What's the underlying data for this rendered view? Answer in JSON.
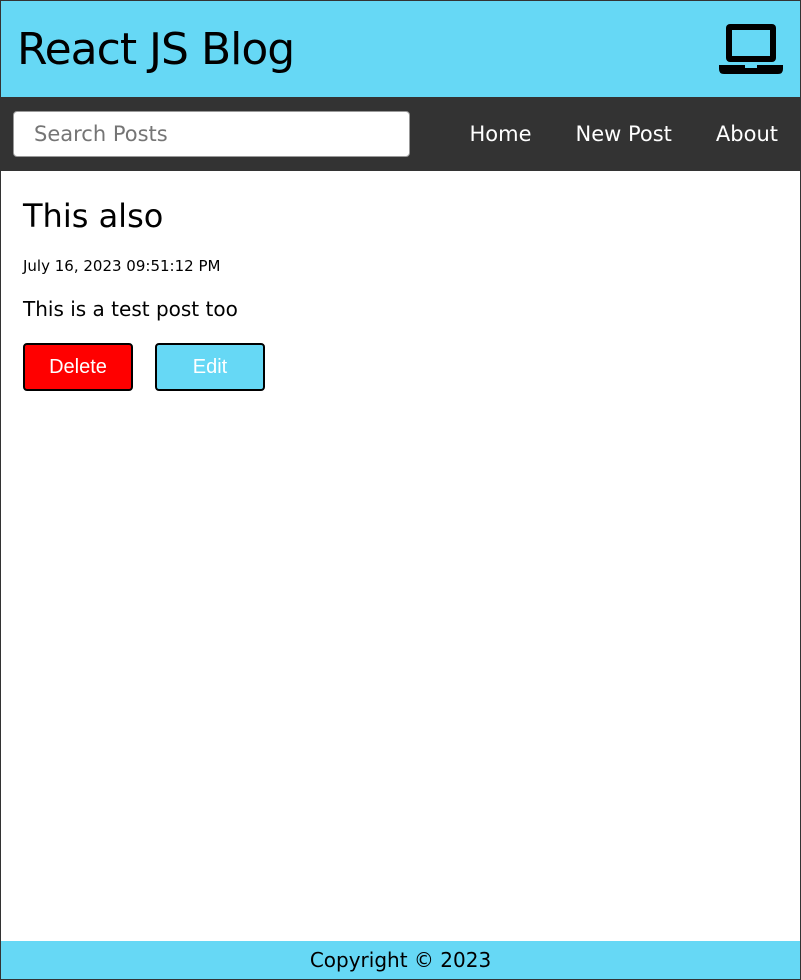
{
  "header": {
    "title": "React JS Blog",
    "icon": "laptop-icon",
    "background_color": "#66d8f5"
  },
  "nav": {
    "search": {
      "placeholder": "Search Posts",
      "value": ""
    },
    "links": [
      {
        "label": "Home"
      },
      {
        "label": "New Post"
      },
      {
        "label": "About"
      }
    ],
    "background_color": "#333333"
  },
  "post": {
    "title": "This also",
    "datetime": "July 16, 2023 09:51:12 PM",
    "body": "This is a test post too",
    "delete_label": "Delete",
    "edit_label": "Edit",
    "delete_color": "#ff0000",
    "edit_color": "#66d8f5"
  },
  "footer": {
    "copyright": "Copyright © 2023"
  }
}
